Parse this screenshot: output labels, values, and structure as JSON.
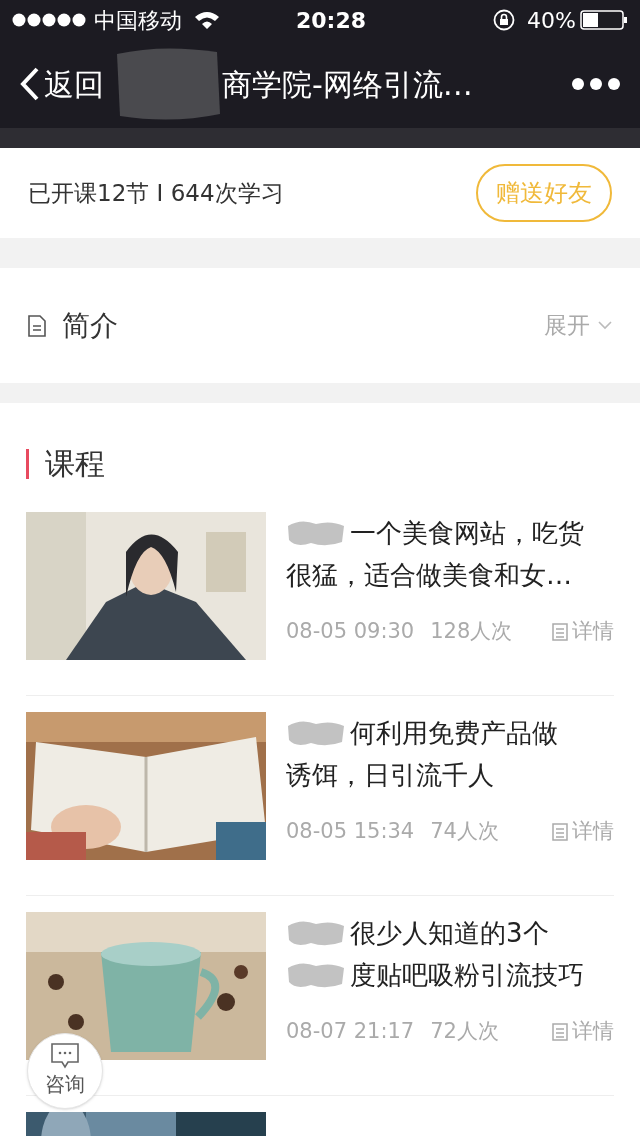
{
  "status_bar": {
    "carrier": "中国移动",
    "time": "20:28",
    "battery": "40%"
  },
  "nav": {
    "back": "返回",
    "title": "商学院-网络引流…"
  },
  "summary": {
    "stats": "已开课12节 I 644次学习",
    "gift_button": "赠送好友"
  },
  "intro": {
    "label": "简介",
    "toggle": "展开"
  },
  "courses": {
    "heading": "课程",
    "items": [
      {
        "lines": [
          {
            "text": "一个美食网站，吃货",
            "redacted": true
          },
          {
            "text": "很猛，适合做美食和女…",
            "redacted": false
          }
        ],
        "date": "08-05 09:30",
        "views": "128人次",
        "detail": "详情",
        "kind": "picture"
      },
      {
        "lines": [
          {
            "text": "何利用免费产品做",
            "redacted": true
          },
          {
            "text": "诱饵，日引流千人",
            "redacted": false
          }
        ],
        "date": "08-05 15:34",
        "views": "74人次",
        "detail": "详情",
        "kind": "picture"
      },
      {
        "lines": [
          {
            "text": "很少人知道的3个",
            "redacted": true
          },
          {
            "text": "度贴吧吸粉引流技巧",
            "redacted": true
          }
        ],
        "date": "08-07 21:17",
        "views": "72人次",
        "detail": "详情",
        "kind": "picture"
      },
      {
        "kind": "picture"
      }
    ]
  },
  "consult": {
    "label": "咨询"
  }
}
